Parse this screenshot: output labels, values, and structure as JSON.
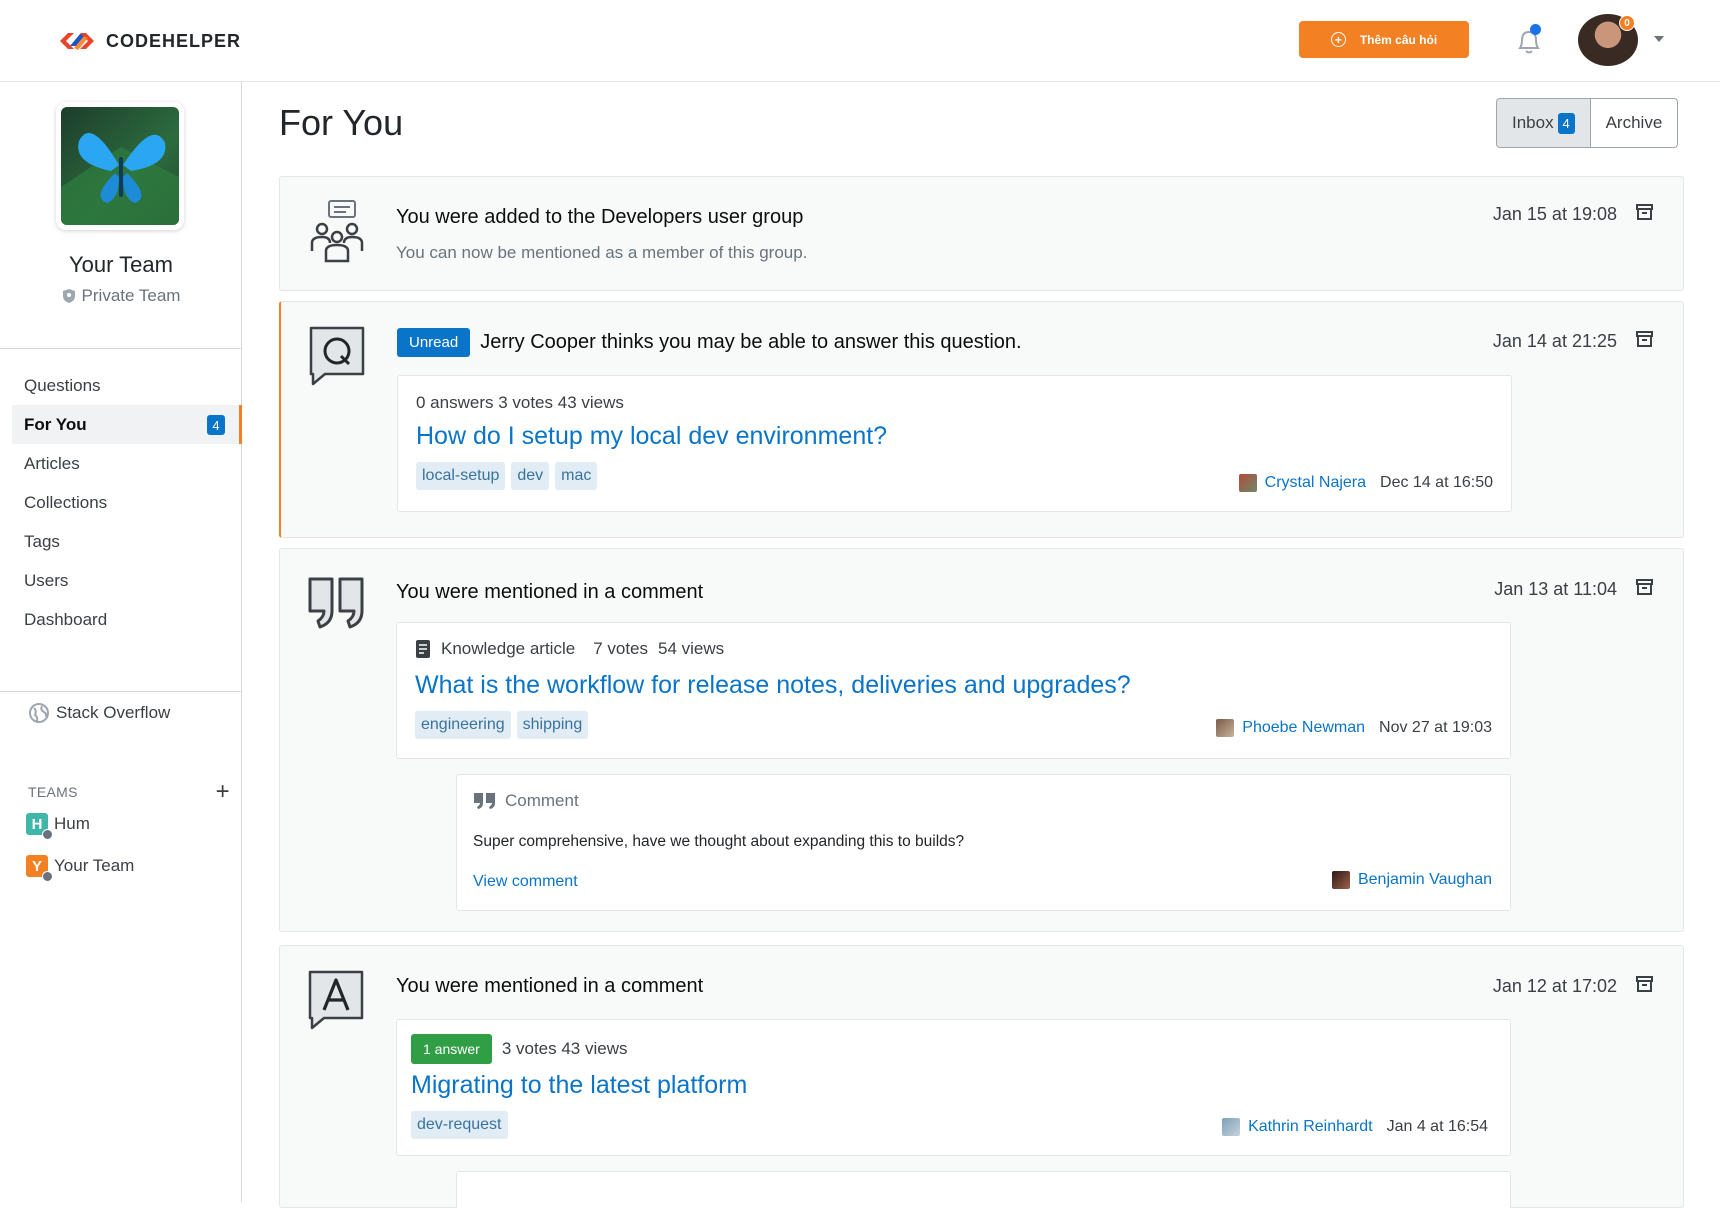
{
  "header": {
    "logo_bold": "CODE",
    "logo_rest": "HELPER",
    "ask_button": "Thêm câu hỏi",
    "avatar_badge": "0"
  },
  "sidebar": {
    "team_name": "Your Team",
    "team_privacy": "Private Team",
    "nav": [
      {
        "label": "Questions"
      },
      {
        "label": "For You",
        "badge": "4"
      },
      {
        "label": "Articles"
      },
      {
        "label": "Collections"
      },
      {
        "label": "Tags"
      },
      {
        "label": "Users"
      },
      {
        "label": "Dashboard"
      }
    ],
    "stack_overflow": "Stack Overflow",
    "teams_heading": "TEAMS",
    "teams": [
      {
        "initial": "H",
        "name": "Hum",
        "color": "#3fb6a8"
      },
      {
        "initial": "Y",
        "name": "Your Team",
        "color": "#f48024"
      }
    ]
  },
  "main": {
    "title": "For You",
    "tabs": {
      "inbox": "Inbox",
      "inbox_count": "4",
      "archive": "Archive"
    },
    "items": [
      {
        "title": "You were added to the Developers user group",
        "subtitle": "You can now be mentioned as a member of this group.",
        "time": "Jan 15 at 19:08"
      },
      {
        "unread_label": "Unread",
        "title": "Jerry Cooper thinks you may be able to answer this question.",
        "time": "Jan 14 at 21:25",
        "post": {
          "stats": "0 answers  3 votes 43 views",
          "title": "How do I setup my local dev environment?",
          "tags": [
            "local-setup",
            "dev",
            "mac"
          ],
          "author": "Crystal Najera",
          "date": "Dec 14 at 16:50"
        }
      },
      {
        "title": "You were mentioned in a comment",
        "time": "Jan 13 at 11:04",
        "post": {
          "type": "Knowledge article",
          "votes": "7 votes",
          "views": "54 views",
          "title": "What is the workflow for release notes, deliveries and upgrades?",
          "tags": [
            "engineering",
            "shipping"
          ],
          "author": "Phoebe Newman",
          "date": "Nov 27 at 19:03"
        },
        "comment": {
          "label": "Comment",
          "text": "Super comprehensive, have we thought about expanding this to builds?",
          "link": "View comment",
          "author": "Benjamin Vaughan"
        }
      },
      {
        "title": "You were mentioned in a comment",
        "time": "Jan 12 at 17:02",
        "post": {
          "answers": "1 answer",
          "stats": "3 votes 43 views",
          "title": "Migrating to the latest platform",
          "tags": [
            "dev-request"
          ],
          "author": "Kathrin Reinhardt",
          "date": "Jan 4 at 16:54"
        }
      }
    ]
  },
  "colors": {
    "accent": "#f48024",
    "link": "#0a74c9",
    "tag_bg": "#e1ecf4",
    "answer_green": "#2f9e44"
  }
}
